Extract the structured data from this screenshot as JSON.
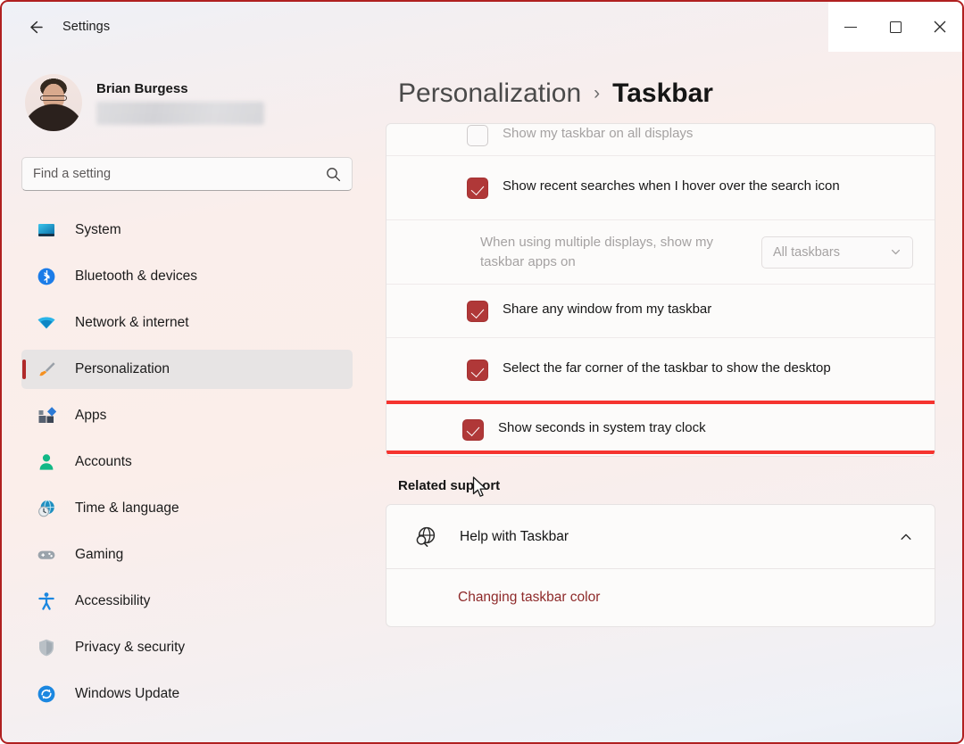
{
  "window": {
    "title": "Settings",
    "back_icon": "back-arrow-icon",
    "minimize_label": "Minimize",
    "maximize_label": "Maximize",
    "close_label": "Close"
  },
  "account": {
    "name": "Brian Burgess",
    "email_hidden": ""
  },
  "search": {
    "placeholder": "Find a setting",
    "value": "",
    "icon": "search-icon"
  },
  "sidebar": {
    "items": [
      {
        "label": "System",
        "icon": "monitor-icon",
        "active": false
      },
      {
        "label": "Bluetooth & devices",
        "icon": "bluetooth-icon",
        "active": false
      },
      {
        "label": "Network & internet",
        "icon": "wifi-icon",
        "active": false
      },
      {
        "label": "Personalization",
        "icon": "paintbrush-icon",
        "active": true
      },
      {
        "label": "Apps",
        "icon": "apps-icon",
        "active": false
      },
      {
        "label": "Accounts",
        "icon": "person-icon",
        "active": false
      },
      {
        "label": "Time & language",
        "icon": "clock-globe-icon",
        "active": false
      },
      {
        "label": "Gaming",
        "icon": "gamepad-icon",
        "active": false
      },
      {
        "label": "Accessibility",
        "icon": "accessibility-icon",
        "active": false
      },
      {
        "label": "Privacy & security",
        "icon": "shield-icon",
        "active": false
      },
      {
        "label": "Windows Update",
        "icon": "update-icon",
        "active": false
      }
    ]
  },
  "breadcrumb": {
    "parent": "Personalization",
    "separator": "›",
    "current": "Taskbar"
  },
  "settings": {
    "rows": [
      {
        "label": "Show my taskbar on all displays",
        "checked": false,
        "disabled": true,
        "type": "checkbox"
      },
      {
        "label": "Show recent searches when I hover over the search icon",
        "checked": true,
        "disabled": false,
        "type": "checkbox"
      },
      {
        "label": "When using multiple displays, show my taskbar apps on",
        "type": "dropdown",
        "value": "All taskbars",
        "disabled": true,
        "chevron": "chevron-down-icon"
      },
      {
        "label": "Share any window from my taskbar",
        "checked": true,
        "disabled": false,
        "type": "checkbox"
      },
      {
        "label": "Select the far corner of the taskbar to show the desktop",
        "checked": true,
        "disabled": false,
        "type": "checkbox"
      },
      {
        "label": "Show seconds in system tray clock",
        "checked": true,
        "disabled": false,
        "type": "checkbox",
        "highlighted": true
      }
    ]
  },
  "related_support": {
    "title": "Related support",
    "help": {
      "label": "Help with Taskbar",
      "icon": "globe-search-icon",
      "chevron": "chevron-up-icon",
      "expanded": true
    },
    "links": [
      {
        "label": "Changing taskbar color"
      }
    ]
  },
  "colors": {
    "accent": "#b03838",
    "annotation": "#f5342f",
    "link": "#8e2a2a",
    "window_border": "#b02020",
    "selected_pill": "#e7e4e4"
  },
  "cursor": {
    "icon": "mouse-pointer-icon"
  }
}
